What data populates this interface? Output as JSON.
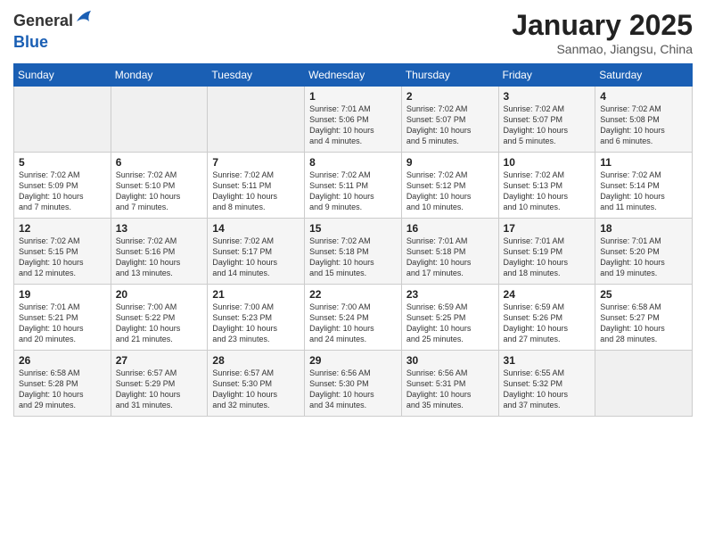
{
  "header": {
    "logo_line1": "General",
    "logo_line2": "Blue",
    "month_title": "January 2025",
    "location": "Sanmao, Jiangsu, China"
  },
  "weekdays": [
    "Sunday",
    "Monday",
    "Tuesday",
    "Wednesday",
    "Thursday",
    "Friday",
    "Saturday"
  ],
  "weeks": [
    [
      {
        "day": "",
        "info": ""
      },
      {
        "day": "",
        "info": ""
      },
      {
        "day": "",
        "info": ""
      },
      {
        "day": "1",
        "info": "Sunrise: 7:01 AM\nSunset: 5:06 PM\nDaylight: 10 hours\nand 4 minutes."
      },
      {
        "day": "2",
        "info": "Sunrise: 7:02 AM\nSunset: 5:07 PM\nDaylight: 10 hours\nand 5 minutes."
      },
      {
        "day": "3",
        "info": "Sunrise: 7:02 AM\nSunset: 5:07 PM\nDaylight: 10 hours\nand 5 minutes."
      },
      {
        "day": "4",
        "info": "Sunrise: 7:02 AM\nSunset: 5:08 PM\nDaylight: 10 hours\nand 6 minutes."
      }
    ],
    [
      {
        "day": "5",
        "info": "Sunrise: 7:02 AM\nSunset: 5:09 PM\nDaylight: 10 hours\nand 7 minutes."
      },
      {
        "day": "6",
        "info": "Sunrise: 7:02 AM\nSunset: 5:10 PM\nDaylight: 10 hours\nand 7 minutes."
      },
      {
        "day": "7",
        "info": "Sunrise: 7:02 AM\nSunset: 5:11 PM\nDaylight: 10 hours\nand 8 minutes."
      },
      {
        "day": "8",
        "info": "Sunrise: 7:02 AM\nSunset: 5:11 PM\nDaylight: 10 hours\nand 9 minutes."
      },
      {
        "day": "9",
        "info": "Sunrise: 7:02 AM\nSunset: 5:12 PM\nDaylight: 10 hours\nand 10 minutes."
      },
      {
        "day": "10",
        "info": "Sunrise: 7:02 AM\nSunset: 5:13 PM\nDaylight: 10 hours\nand 10 minutes."
      },
      {
        "day": "11",
        "info": "Sunrise: 7:02 AM\nSunset: 5:14 PM\nDaylight: 10 hours\nand 11 minutes."
      }
    ],
    [
      {
        "day": "12",
        "info": "Sunrise: 7:02 AM\nSunset: 5:15 PM\nDaylight: 10 hours\nand 12 minutes."
      },
      {
        "day": "13",
        "info": "Sunrise: 7:02 AM\nSunset: 5:16 PM\nDaylight: 10 hours\nand 13 minutes."
      },
      {
        "day": "14",
        "info": "Sunrise: 7:02 AM\nSunset: 5:17 PM\nDaylight: 10 hours\nand 14 minutes."
      },
      {
        "day": "15",
        "info": "Sunrise: 7:02 AM\nSunset: 5:18 PM\nDaylight: 10 hours\nand 15 minutes."
      },
      {
        "day": "16",
        "info": "Sunrise: 7:01 AM\nSunset: 5:18 PM\nDaylight: 10 hours\nand 17 minutes."
      },
      {
        "day": "17",
        "info": "Sunrise: 7:01 AM\nSunset: 5:19 PM\nDaylight: 10 hours\nand 18 minutes."
      },
      {
        "day": "18",
        "info": "Sunrise: 7:01 AM\nSunset: 5:20 PM\nDaylight: 10 hours\nand 19 minutes."
      }
    ],
    [
      {
        "day": "19",
        "info": "Sunrise: 7:01 AM\nSunset: 5:21 PM\nDaylight: 10 hours\nand 20 minutes."
      },
      {
        "day": "20",
        "info": "Sunrise: 7:00 AM\nSunset: 5:22 PM\nDaylight: 10 hours\nand 21 minutes."
      },
      {
        "day": "21",
        "info": "Sunrise: 7:00 AM\nSunset: 5:23 PM\nDaylight: 10 hours\nand 23 minutes."
      },
      {
        "day": "22",
        "info": "Sunrise: 7:00 AM\nSunset: 5:24 PM\nDaylight: 10 hours\nand 24 minutes."
      },
      {
        "day": "23",
        "info": "Sunrise: 6:59 AM\nSunset: 5:25 PM\nDaylight: 10 hours\nand 25 minutes."
      },
      {
        "day": "24",
        "info": "Sunrise: 6:59 AM\nSunset: 5:26 PM\nDaylight: 10 hours\nand 27 minutes."
      },
      {
        "day": "25",
        "info": "Sunrise: 6:58 AM\nSunset: 5:27 PM\nDaylight: 10 hours\nand 28 minutes."
      }
    ],
    [
      {
        "day": "26",
        "info": "Sunrise: 6:58 AM\nSunset: 5:28 PM\nDaylight: 10 hours\nand 29 minutes."
      },
      {
        "day": "27",
        "info": "Sunrise: 6:57 AM\nSunset: 5:29 PM\nDaylight: 10 hours\nand 31 minutes."
      },
      {
        "day": "28",
        "info": "Sunrise: 6:57 AM\nSunset: 5:30 PM\nDaylight: 10 hours\nand 32 minutes."
      },
      {
        "day": "29",
        "info": "Sunrise: 6:56 AM\nSunset: 5:30 PM\nDaylight: 10 hours\nand 34 minutes."
      },
      {
        "day": "30",
        "info": "Sunrise: 6:56 AM\nSunset: 5:31 PM\nDaylight: 10 hours\nand 35 minutes."
      },
      {
        "day": "31",
        "info": "Sunrise: 6:55 AM\nSunset: 5:32 PM\nDaylight: 10 hours\nand 37 minutes."
      },
      {
        "day": "",
        "info": ""
      }
    ]
  ]
}
